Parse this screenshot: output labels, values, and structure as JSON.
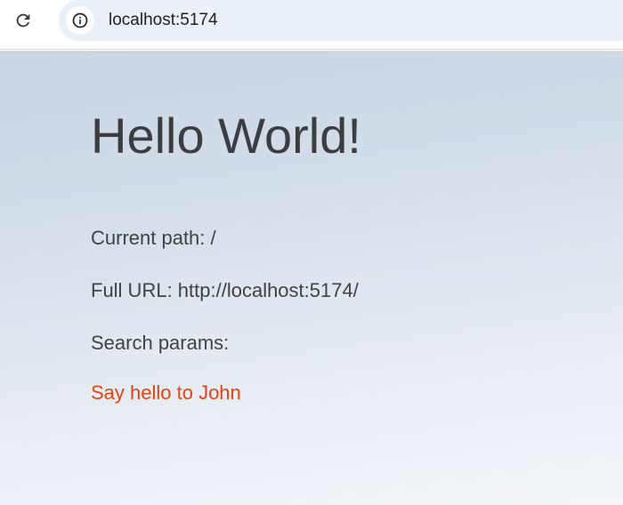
{
  "browser": {
    "url": "localhost:5174",
    "icons": {
      "reload": "reload-icon",
      "info": "info-icon"
    }
  },
  "page": {
    "title": "Hello World!",
    "current_path": "Current path: /",
    "full_url": "Full URL: http://localhost:5174/",
    "search_params": "Search params:",
    "link_label": "Say hello to John",
    "link_color": "#e8430e"
  }
}
